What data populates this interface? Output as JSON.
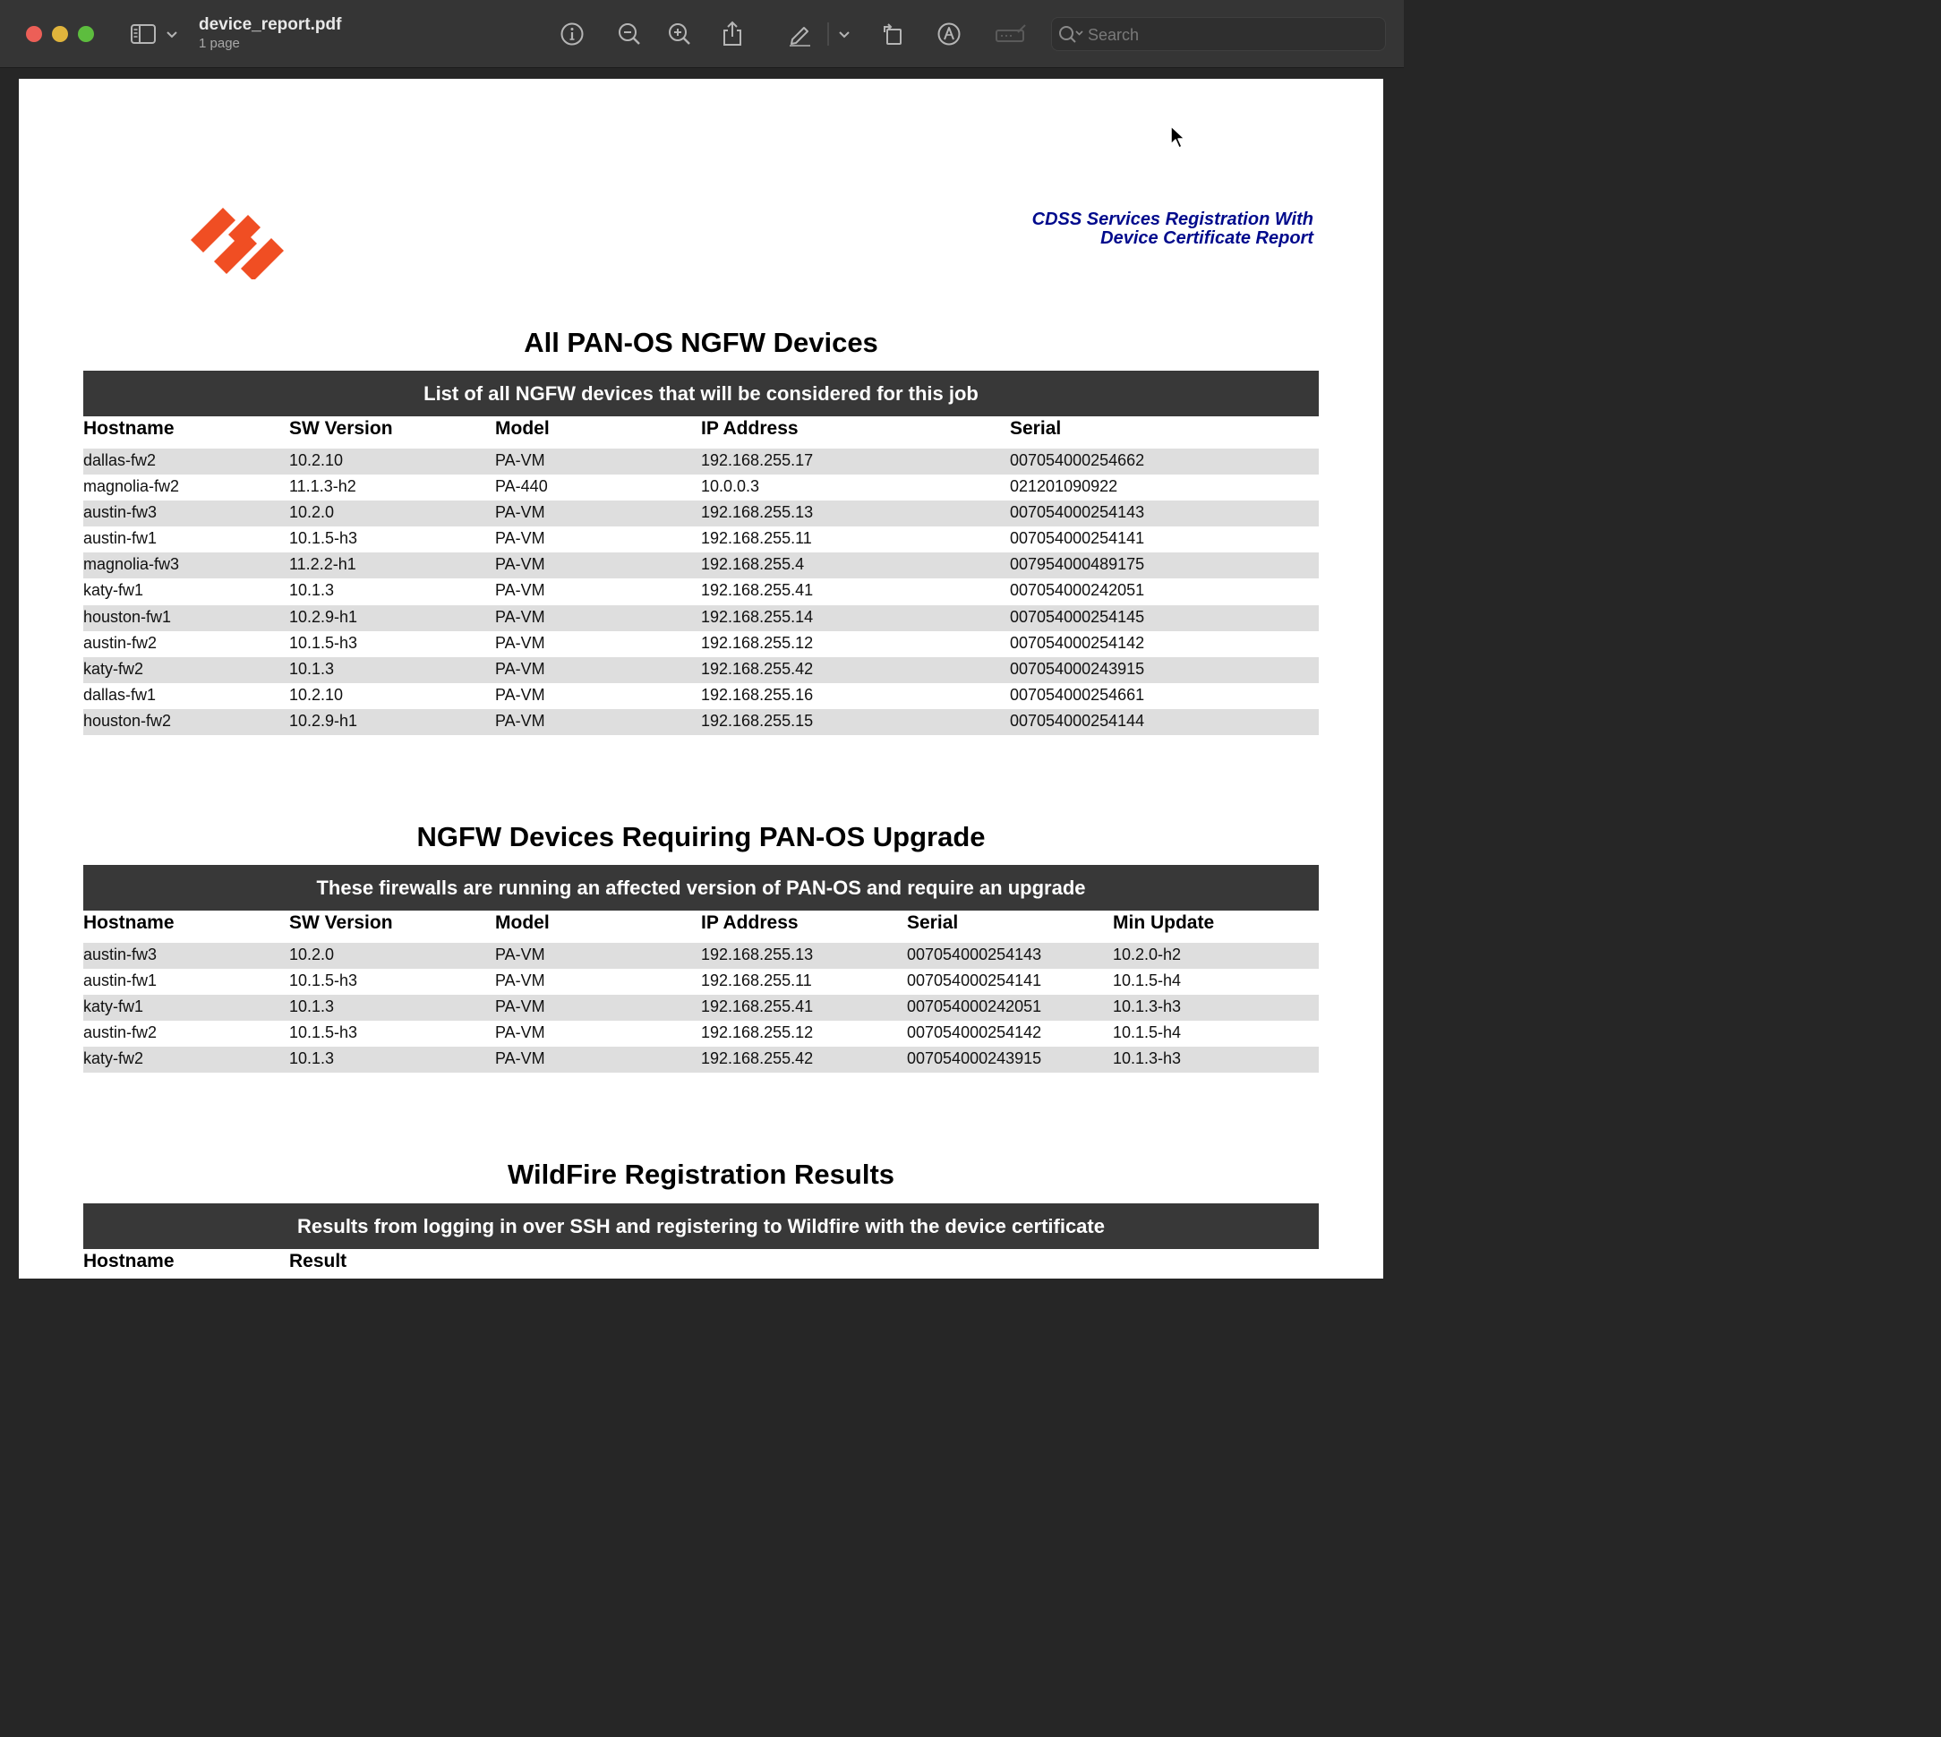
{
  "window": {
    "file_name": "device_report.pdf",
    "page_count": "1 page",
    "search_placeholder": "Search",
    "traffic_lights": [
      "#ec5f57",
      "#e0b43c",
      "#5dbd3e"
    ]
  },
  "toolbar": {
    "icons": [
      "sidebar-toggle-icon",
      "chevron-down-icon",
      "info-icon",
      "zoom-out-icon",
      "zoom-in-icon",
      "share-icon",
      "markup-pen-icon",
      "chevron-down-icon",
      "rotate-icon",
      "annotate-icon",
      "form-fill-icon",
      "search-icon"
    ]
  },
  "document": {
    "report_title_line1": "CDSS Services Registration With",
    "report_title_line2": "Device Certificate Report",
    "title_color": "#000a8c",
    "logo_color": "#f04e23",
    "sections": {
      "all_devices": {
        "heading": "All PAN-OS NGFW Devices",
        "banner": "List of all NGFW devices that will be considered for this job",
        "columns": [
          "Hostname",
          "SW Version",
          "Model",
          "IP Address",
          "Serial"
        ],
        "rows": [
          [
            "dallas-fw2",
            "10.2.10",
            "PA-VM",
            "192.168.255.17",
            "007054000254662"
          ],
          [
            "magnolia-fw2",
            "11.1.3-h2",
            "PA-440",
            "10.0.0.3",
            "021201090922"
          ],
          [
            "austin-fw3",
            "10.2.0",
            "PA-VM",
            "192.168.255.13",
            "007054000254143"
          ],
          [
            "austin-fw1",
            "10.1.5-h3",
            "PA-VM",
            "192.168.255.11",
            "007054000254141"
          ],
          [
            "magnolia-fw3",
            "11.2.2-h1",
            "PA-VM",
            "192.168.255.4",
            "007954000489175"
          ],
          [
            "katy-fw1",
            "10.1.3",
            "PA-VM",
            "192.168.255.41",
            "007054000242051"
          ],
          [
            "houston-fw1",
            "10.2.9-h1",
            "PA-VM",
            "192.168.255.14",
            "007054000254145"
          ],
          [
            "austin-fw2",
            "10.1.5-h3",
            "PA-VM",
            "192.168.255.12",
            "007054000254142"
          ],
          [
            "katy-fw2",
            "10.1.3",
            "PA-VM",
            "192.168.255.42",
            "007054000243915"
          ],
          [
            "dallas-fw1",
            "10.2.10",
            "PA-VM",
            "192.168.255.16",
            "007054000254661"
          ],
          [
            "houston-fw2",
            "10.2.9-h1",
            "PA-VM",
            "192.168.255.15",
            "007054000254144"
          ]
        ]
      },
      "upgrade": {
        "heading": "NGFW Devices Requiring PAN-OS Upgrade",
        "banner": "These firewalls are running an affected version of PAN-OS and require an upgrade",
        "columns": [
          "Hostname",
          "SW Version",
          "Model",
          "IP Address",
          "Serial",
          "Min Update"
        ],
        "rows": [
          [
            "austin-fw3",
            "10.2.0",
            "PA-VM",
            "192.168.255.13",
            "007054000254143",
            "10.2.0-h2"
          ],
          [
            "austin-fw1",
            "10.1.5-h3",
            "PA-VM",
            "192.168.255.11",
            "007054000254141",
            "10.1.5-h4"
          ],
          [
            "katy-fw1",
            "10.1.3",
            "PA-VM",
            "192.168.255.41",
            "007054000242051",
            "10.1.3-h3"
          ],
          [
            "austin-fw2",
            "10.1.5-h3",
            "PA-VM",
            "192.168.255.12",
            "007054000254142",
            "10.1.5-h4"
          ],
          [
            "katy-fw2",
            "10.1.3",
            "PA-VM",
            "192.168.255.42",
            "007054000243915",
            "10.1.3-h3"
          ]
        ]
      },
      "wildfire": {
        "heading": "WildFire Registration Results",
        "banner": "Results from logging in over SSH and registering to Wildfire with the device certificate",
        "columns": [
          "Hostname",
          "Result"
        ]
      }
    }
  }
}
